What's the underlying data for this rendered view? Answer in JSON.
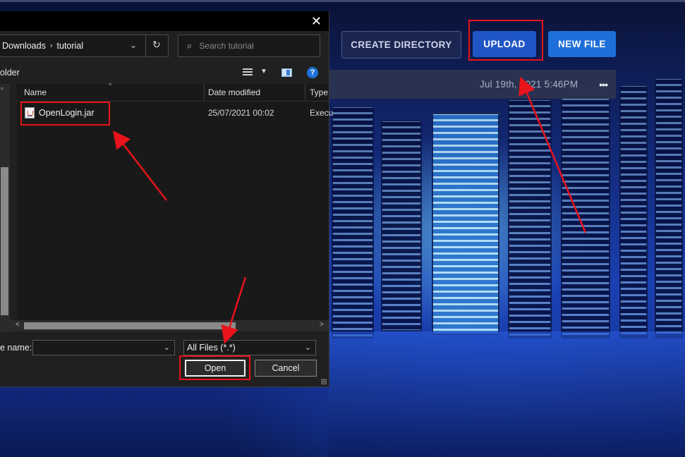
{
  "web_app": {
    "buttons": {
      "create_directory": "CREATE DIRECTORY",
      "upload": "UPLOAD",
      "new_file": "NEW FILE"
    },
    "file_row": {
      "modified": "Jul 19th, 2021 5:46PM",
      "more_label": "•••"
    }
  },
  "dialog": {
    "close_glyph": "✕",
    "address": {
      "segments": [
        "Downloads",
        "tutorial"
      ],
      "separator": "›",
      "dropdown_glyph": "⌄",
      "refresh_glyph": "↻"
    },
    "search": {
      "placeholder": "Search tutorial",
      "icon_glyph": "⌕"
    },
    "toolbar": {
      "new_folder_label": "older",
      "view_caret": "▼",
      "help_glyph": "?"
    },
    "columns": {
      "name": "Name",
      "date_modified": "Date modified",
      "type": "Type"
    },
    "files": [
      {
        "name": "OpenLogin.jar",
        "date_modified": "25/07/2021 00:02",
        "type": "Execu"
      }
    ],
    "file_name_label": "e name:",
    "file_name_value": "",
    "file_type": "All Files (*.*)",
    "open_label": "Open",
    "cancel_label": "Cancel"
  },
  "annotation_color": "#e8131b",
  "icons": [
    "close-icon",
    "chevron-right-icon",
    "chevron-down-icon",
    "refresh-icon",
    "search-icon",
    "view-options-icon",
    "preview-pane-icon",
    "help-icon",
    "jar-file-icon",
    "resize-grip-icon"
  ]
}
